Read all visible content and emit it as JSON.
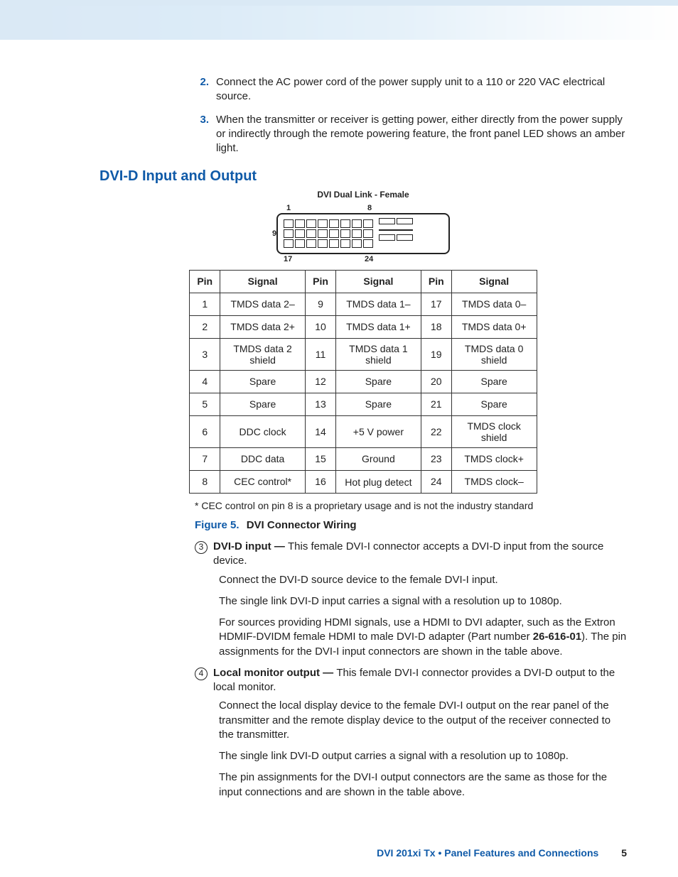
{
  "steps": [
    {
      "n": "2.",
      "text": "Connect the AC power cord of the power supply unit to a 110 or 220 VAC electrical source."
    },
    {
      "n": "3.",
      "text": "When the transmitter or receiver is getting power, either directly from the power supply or indirectly through the remote powering feature, the front panel LED shows an amber light."
    }
  ],
  "section_heading": "DVI-D Input and Output",
  "connector_title": "DVI Dual Link - Female",
  "pin_labels": {
    "tl": "1",
    "tr": "8",
    "ml": "9",
    "bl": "17",
    "br": "24"
  },
  "table": {
    "headers": [
      "Pin",
      "Signal",
      "Pin",
      "Signal",
      "Pin",
      "Signal"
    ],
    "rows": [
      [
        "1",
        "TMDS data 2–",
        "9",
        "TMDS data 1–",
        "17",
        "TMDS data 0–"
      ],
      [
        "2",
        "TMDS data 2+",
        "10",
        "TMDS data 1+",
        "18",
        "TMDS data 0+"
      ],
      [
        "3",
        "TMDS data 2 shield",
        "11",
        "TMDS data 1 shield",
        "19",
        "TMDS data 0 shield"
      ],
      [
        "4",
        "Spare",
        "12",
        "Spare",
        "20",
        "Spare"
      ],
      [
        "5",
        "Spare",
        "13",
        "Spare",
        "21",
        "Spare"
      ],
      [
        "6",
        "DDC clock",
        "14",
        "+5 V power",
        "22",
        "TMDS clock shield"
      ],
      [
        "7",
        "DDC data",
        "15",
        "Ground",
        "23",
        "TMDS clock+"
      ],
      [
        "8",
        "CEC control*",
        "16",
        "Hot plug detect",
        "24",
        "TMDS clock–"
      ]
    ]
  },
  "footnote": "*  CEC control on pin 8 is a proprietary usage and is not the industry standard",
  "figure": {
    "lead": "Figure 5.",
    "caption": "DVI Connector Wiring"
  },
  "callouts": [
    {
      "mark": "3",
      "lead": "DVI-D input — ",
      "first": "This female DVI-I connector accepts a DVI-D input from the source device.",
      "paras": [
        "Connect the DVI-D source device to the female DVI-I input.",
        "The single link DVI-D input carries a signal with a resolution up to 1080p."
      ],
      "tail_pre": "For sources providing HDMI signals, use a HDMI to DVI adapter, such as the Extron HDMIF-DVIDM female HDMI to male DVI-D adapter (Part number ",
      "partnum": "26-616-01",
      "tail_post": "). The pin assignments for the DVI-I input connectors are shown in the table above."
    },
    {
      "mark": "4",
      "lead": "Local monitor output — ",
      "first": "This female DVI-I connector provides a DVI-D output to the local monitor.",
      "paras": [
        "Connect the local display device to the female DVI-I output on the rear panel of the transmitter and the remote display device to the output of the receiver connected to the transmitter.",
        "The single link DVI-D output carries a signal with a resolution up to 1080p.",
        "The pin assignments for the DVI-I output connectors are the same as those for the input connections and are shown in the table above."
      ]
    }
  ],
  "footer": {
    "product": "DVI 201xi Tx • Panel Features and Connections",
    "page": "5"
  }
}
